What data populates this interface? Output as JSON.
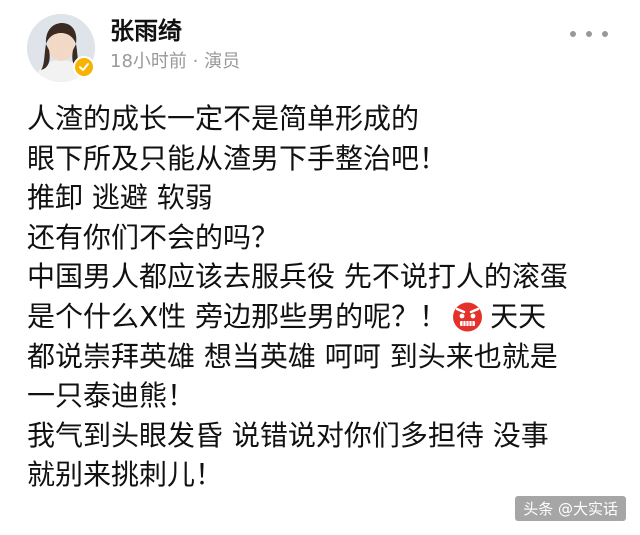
{
  "author": {
    "name": "张雨绮",
    "meta": "18小时前 · 演员",
    "verified_color": "#f6b400"
  },
  "post": {
    "lines": [
      "人渣的成长一定不是简单形成的",
      "眼下所及只能从渣男下手整治吧！",
      "推卸 逃避 软弱",
      "还有你们不会的吗？",
      "中国男人都应该去服兵役 先不说打人的滚蛋",
      "是个什么X性 旁边那些男的呢？！",
      "都说崇拜英雄 想当英雄 呵呵 到头来也就是",
      "一只泰迪熊！",
      "我气到头眼发昏 说错说对你们多担待 没事",
      "就别来挑刺儿！"
    ],
    "line6_tail": "天天",
    "emoji": "angry-face"
  },
  "watermark": {
    "text": "头条 @大实话"
  },
  "icons": {
    "more": "more-icon",
    "verified": "verified-badge-icon"
  }
}
